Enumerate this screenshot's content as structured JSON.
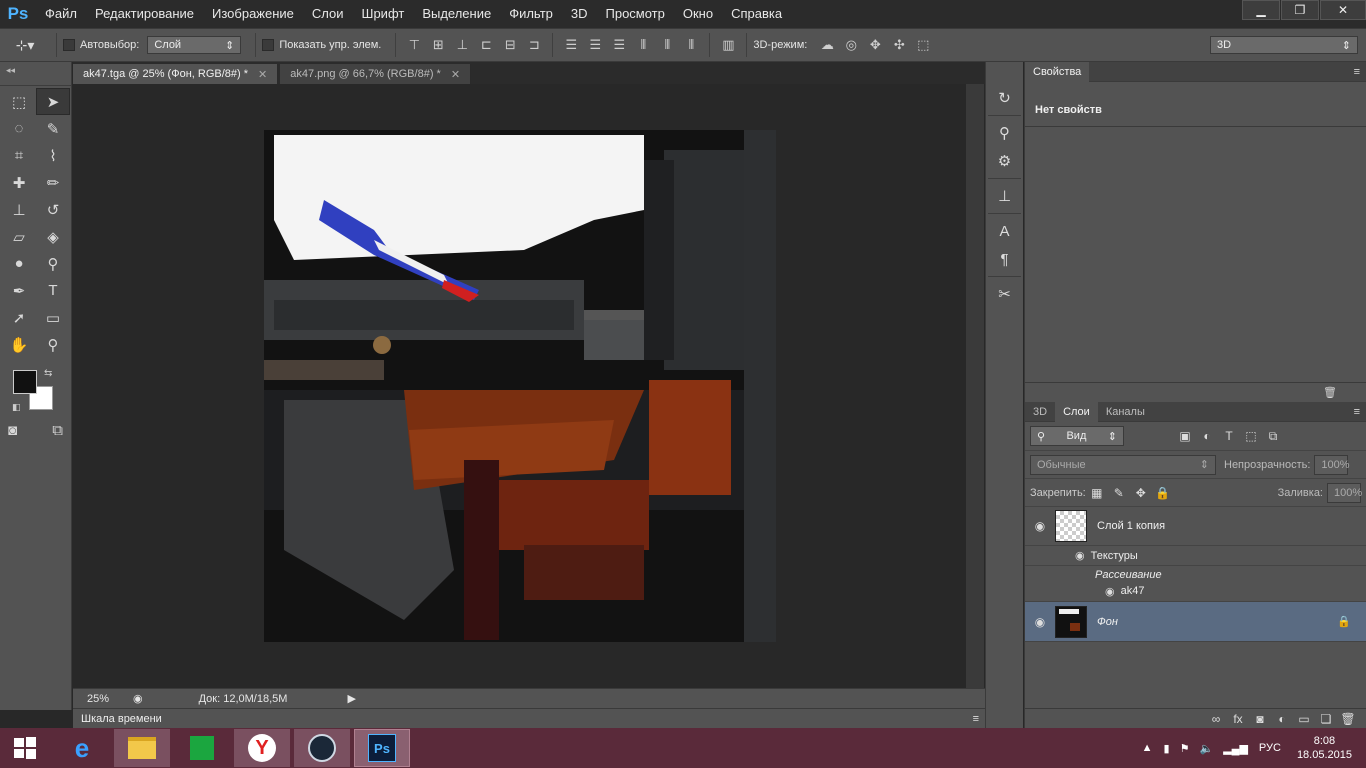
{
  "menubar": {
    "logo": "Ps",
    "items": [
      "Файл",
      "Редактирование",
      "Изображение",
      "Слои",
      "Шрифт",
      "Выделение",
      "Фильтр",
      "3D",
      "Просмотр",
      "Окно",
      "Справка"
    ]
  },
  "options_bar": {
    "autoselect_label": "Автовыбор:",
    "autoselect_value": "Слой",
    "show_controls_label": "Показать упр. элем.",
    "mode_3d_label": "3D-режим:",
    "workspace_value": "3D"
  },
  "tabs": [
    {
      "label": "ak47.tga @ 25% (Фон, RGB/8#) *",
      "active": true
    },
    {
      "label": "ak47.png @ 66,7% (RGB/8#) *",
      "active": false
    }
  ],
  "status": {
    "zoom": "25%",
    "doc_size": "Док: 12,0M/18,5M"
  },
  "timeline": {
    "label": "Шкала времени"
  },
  "properties": {
    "tab": "Свойства",
    "empty_text": "Нет свойств"
  },
  "layers_panel": {
    "tabs": [
      "3D",
      "Слои",
      "Каналы"
    ],
    "active_tab": "Слои",
    "filter_value": "Вид",
    "blend_mode": "Обычные",
    "opacity_label": "Непрозрачность:",
    "opacity_value": "100%",
    "lock_label": "Закрепить:",
    "fill_label": "Заливка:",
    "fill_value": "100%",
    "layers": [
      {
        "name": "Слой 1 копия",
        "selected": false
      },
      {
        "name": "Фон",
        "selected": true
      }
    ],
    "textures_label": "Текстуры",
    "diffuse_label": "Рассеивание",
    "texture_name": "ak47"
  },
  "taskbar": {
    "language": "РУС",
    "time": "8:08",
    "date": "18.05.2015"
  },
  "colors": {
    "foreground": "#111111",
    "background": "#ffffff",
    "accent": "#4fb4ff",
    "taskbar": "#5a2a3a"
  }
}
